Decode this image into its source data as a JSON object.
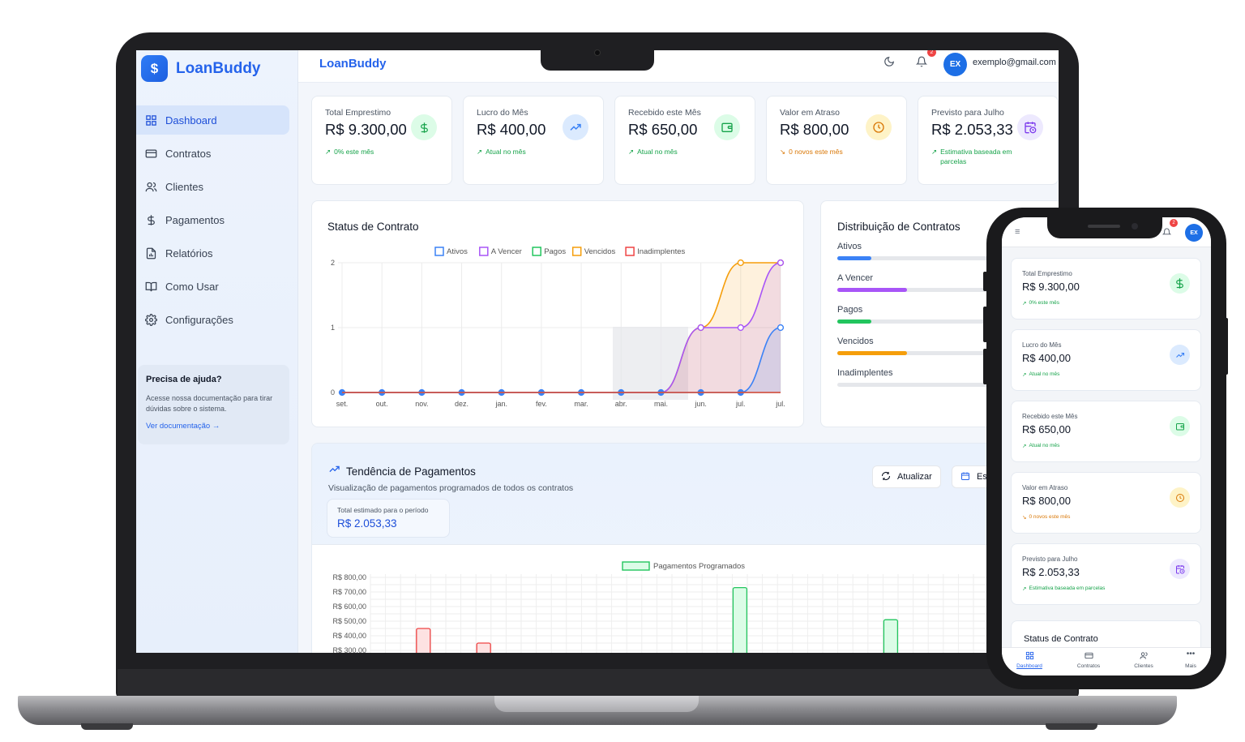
{
  "app": {
    "brand": "LoanBuddy",
    "topbar_title": "LoanBuddy",
    "logo_symbol": "$"
  },
  "sidebar": {
    "items": [
      {
        "label": "Dashboard",
        "icon": "grid-icon",
        "active": true
      },
      {
        "label": "Contratos",
        "icon": "card-icon",
        "active": false
      },
      {
        "label": "Clientes",
        "icon": "users-icon",
        "active": false
      },
      {
        "label": "Pagamentos",
        "icon": "dollar-icon",
        "active": false
      },
      {
        "label": "Relatórios",
        "icon": "report-icon",
        "active": false
      },
      {
        "label": "Como Usar",
        "icon": "book-icon",
        "active": false
      },
      {
        "label": "Configurações",
        "icon": "gear-icon",
        "active": false
      }
    ],
    "help": {
      "title": "Precisa de ajuda?",
      "text": "Acesse nossa documentação para tirar dúvidas sobre o sistema.",
      "link": "Ver documentação →"
    }
  },
  "topbar": {
    "avatar": "EX",
    "email": "exemplo@gmail.com",
    "notifications": "2"
  },
  "stats": [
    {
      "title": "Total Emprestimo",
      "value": "R$ 9.300,00",
      "sub": "0% este mês",
      "arrow": "↗",
      "color": "#16a34a",
      "icon": "dollar-icon",
      "icon_bg": "#dcfce7"
    },
    {
      "title": "Lucro do Mês",
      "value": "R$ 400,00",
      "sub": "Atual no mês",
      "arrow": "↗",
      "color": "#16a34a",
      "icon": "trending-up-icon",
      "icon_bg": "#dbeafe"
    },
    {
      "title": "Recebido este Mês",
      "value": "R$ 650,00",
      "sub": "Atual no mês",
      "arrow": "↗",
      "color": "#16a34a",
      "icon": "wallet-icon",
      "icon_bg": "#dcfce7"
    },
    {
      "title": "Valor em Atraso",
      "value": "R$ 800,00",
      "sub": "0 novos este mês",
      "arrow": "↘",
      "color": "#d97706",
      "icon": "clock-icon",
      "icon_bg": "#fef3c7"
    },
    {
      "title": "Previsto para Julho",
      "value": "R$ 2.053,33",
      "sub": "Estimativa baseada em parcelas",
      "arrow": "↗",
      "color": "#16a34a",
      "icon": "calendar-clock-icon",
      "icon_bg": "#ede9fe"
    }
  ],
  "status_chart": {
    "title": "Status de Contrato"
  },
  "distribution": {
    "title": "Distribuição de Contratos",
    "rows": [
      {
        "label": "Ativos",
        "fraction": 0.16,
        "color": "#3b82f6"
      },
      {
        "label": "A Vencer",
        "fraction": 0.33,
        "color": "#a855f7"
      },
      {
        "label": "Pagos",
        "fraction": 0.16,
        "color": "#22c55e"
      },
      {
        "label": "Vencidos",
        "fraction": 0.33,
        "color": "#f59e0b"
      },
      {
        "label": "Inadimplentes",
        "fraction": 0,
        "color": "#ef4444"
      }
    ]
  },
  "trend": {
    "title": "Tendência de Pagamentos",
    "subtitle": "Visualização de pagamentos programados de todos os contratos",
    "total_label": "Total estimado para o período",
    "total_value": "R$ 2.053,33",
    "refresh_label": "Atualizar",
    "period_label": "Este"
  },
  "mobile": {
    "avatar": "EX",
    "notifications": "2",
    "next_section": "Status de Contrato",
    "tabs": [
      "Dashboard",
      "Contratos",
      "Clientes",
      "Mais"
    ]
  },
  "chart_data": [
    {
      "type": "area",
      "title": "Status de Contrato",
      "categories": [
        "set.",
        "out.",
        "nov.",
        "dez.",
        "jan.",
        "fev.",
        "mar.",
        "abr.",
        "mai.",
        "jun.",
        "jul.",
        "jul."
      ],
      "ylim": [
        0,
        2
      ],
      "yticks": [
        0,
        1,
        2
      ],
      "grid": true,
      "legend": "top",
      "series": [
        {
          "name": "Ativos",
          "color": "#3b82f6",
          "values": [
            0,
            0,
            0,
            0,
            0,
            0,
            0,
            0,
            0,
            0,
            0,
            1
          ]
        },
        {
          "name": "A Vencer",
          "color": "#a855f7",
          "values": [
            0,
            0,
            0,
            0,
            0,
            0,
            0,
            0,
            0,
            1,
            1,
            2
          ]
        },
        {
          "name": "Pagos",
          "color": "#22c55e",
          "values": [
            0,
            0,
            0,
            0,
            0,
            0,
            0,
            0,
            0,
            0,
            0,
            0
          ]
        },
        {
          "name": "Vencidos",
          "color": "#f59e0b",
          "values": [
            0,
            0,
            0,
            0,
            0,
            0,
            0,
            0,
            0,
            1,
            2,
            2
          ]
        },
        {
          "name": "Inadimplentes",
          "color": "#ef4444",
          "values": [
            0,
            0,
            0,
            0,
            0,
            0,
            0,
            0,
            0,
            0,
            0,
            0
          ]
        }
      ]
    },
    {
      "type": "bar",
      "series_name": "Pagamentos Programados",
      "yticks": [
        "R$ 800,00",
        "R$ 700,00",
        "R$ 600,00",
        "R$ 500,00",
        "R$ 400,00",
        "R$ 300,00"
      ],
      "ylim": [
        300,
        800
      ],
      "legend": "top",
      "grid": true,
      "bars": [
        {
          "slot": 3,
          "value": 450,
          "color": "#ef4444"
        },
        {
          "slot": 7,
          "value": 350,
          "color": "#ef4444"
        },
        {
          "slot": 24,
          "value": 730,
          "color": "#22c55e"
        },
        {
          "slot": 34,
          "value": 510,
          "color": "#22c55e"
        }
      ]
    }
  ]
}
